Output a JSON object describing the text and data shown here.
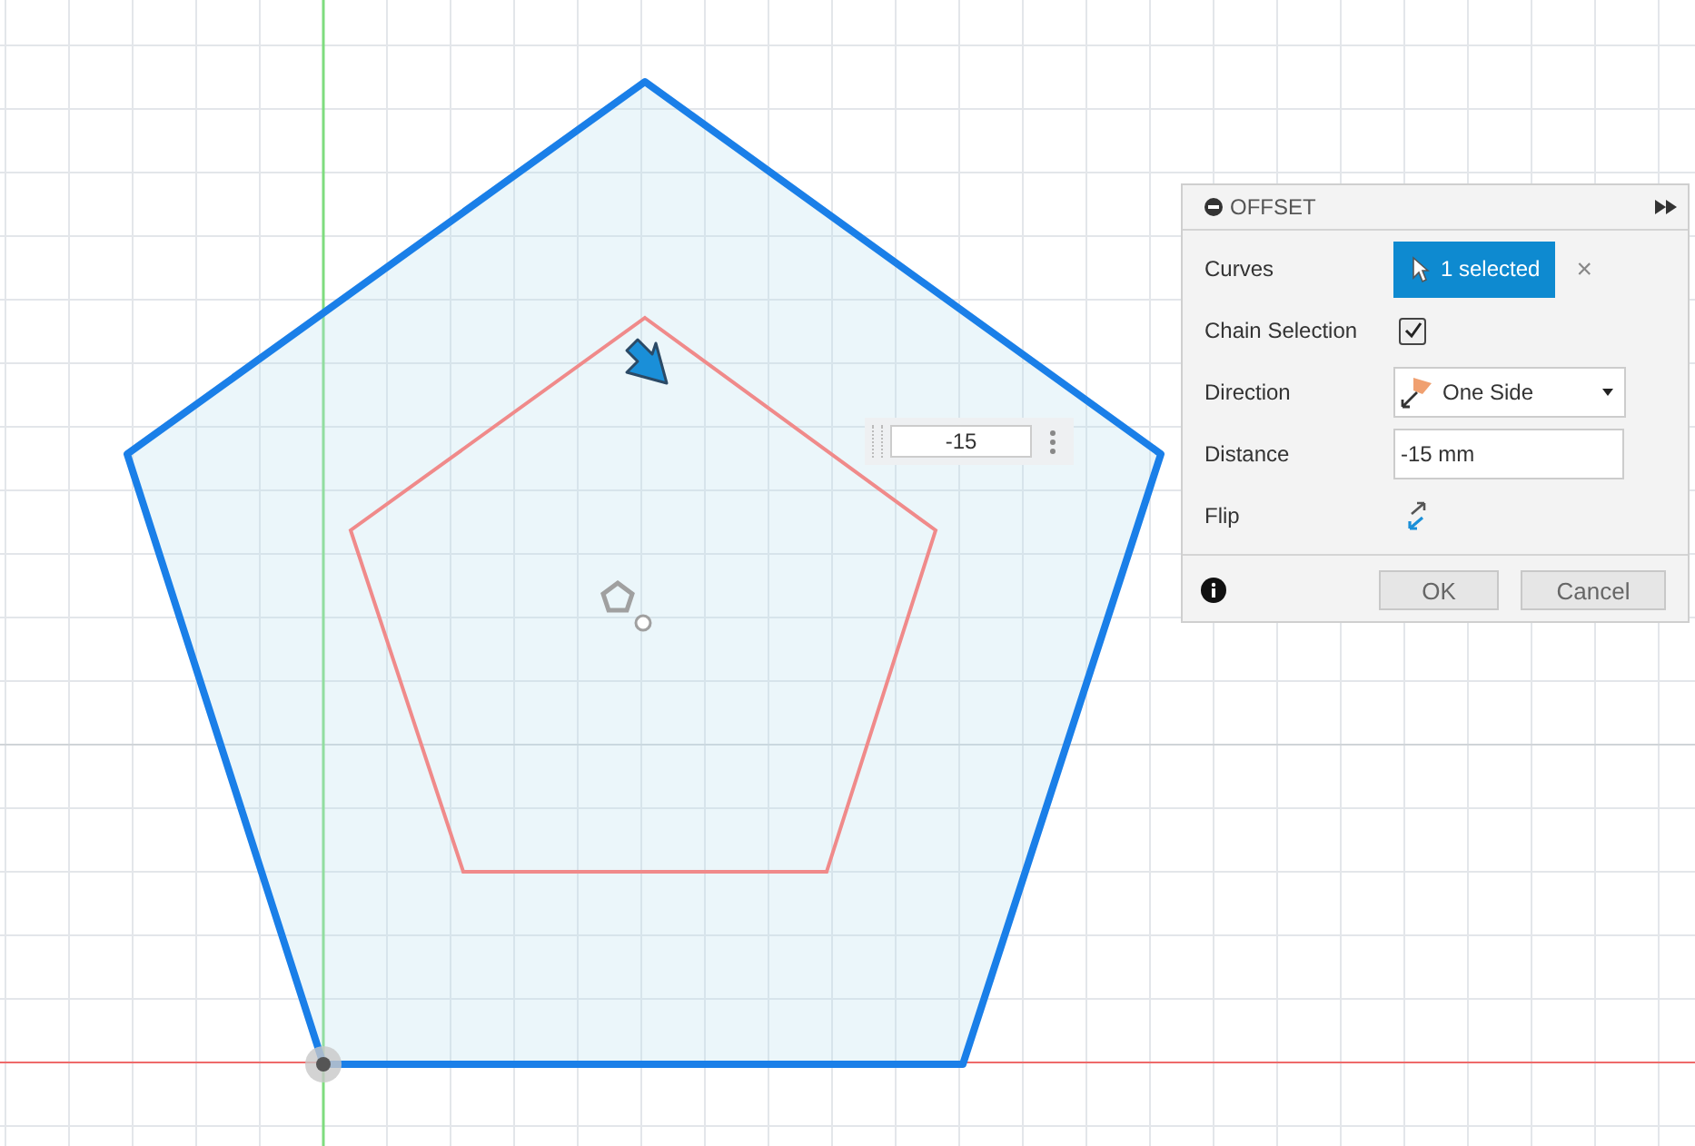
{
  "dimension_input": {
    "value": "-15"
  },
  "dialog": {
    "title": "OFFSET",
    "rows": [
      {
        "kind": "selection",
        "label": "Curves",
        "value": "1 selected",
        "clear": "×"
      },
      {
        "kind": "checkbox",
        "label": "Chain Selection",
        "checked": true
      },
      {
        "kind": "dropdown",
        "label": "Direction",
        "value": "One Side"
      },
      {
        "kind": "input",
        "label": "Distance",
        "value": "-15 mm"
      },
      {
        "kind": "flip",
        "label": "Flip"
      }
    ],
    "buttons": [
      "OK",
      "Cancel"
    ]
  }
}
